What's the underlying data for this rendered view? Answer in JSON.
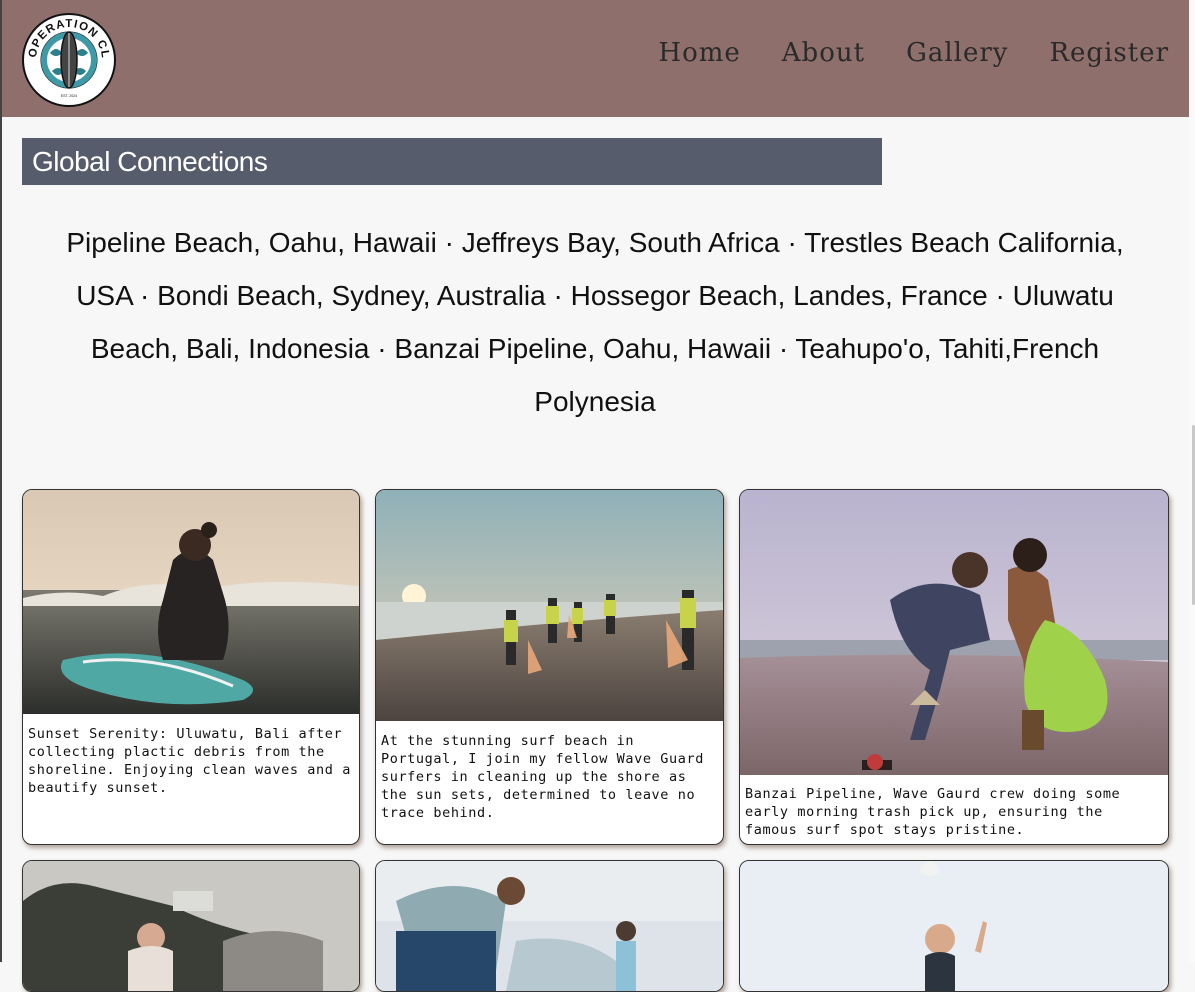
{
  "header": {
    "logo_text": "OPERATION CLEAN RIDE",
    "logo_subtext": "EST. 2024",
    "nav": [
      {
        "label": "Home"
      },
      {
        "label": "About"
      },
      {
        "label": "Gallery"
      },
      {
        "label": "Register"
      }
    ],
    "background_color": "#8f6f6b"
  },
  "section": {
    "title": "Global Connections",
    "bar_color": "#575c6d"
  },
  "locations_text": "Pipeline Beach, Oahu, Hawaii  · Jeffreys Bay, South Africa · Trestles Beach California, USA  · Bondi Beach, Sydney, Australia · Hossegor Beach, Landes, France · Uluwatu Beach, Bali, Indonesia · Banzai Pipeline, Oahu, Hawaii · Teahupo'o, Tahiti,French Polynesia",
  "gallery": [
    {
      "image": "surfer-sitting-on-board-in-ocean-at-sunset",
      "caption": "Sunset Serenity: Uluwatu, Bali after collecting plactic debris from the shoreline. Enjoying clean waves and a beautify sunset."
    },
    {
      "image": "volunteers-in-vests-collecting-trash-on-beach-at-sunset",
      "caption": "At the stunning surf beach in Portugal, I join my fellow Wave Guard surfers in cleaning up the shore as the sun sets, determined to leave no trace behind."
    },
    {
      "image": "two-people-picking-up-trash-with-green-bag",
      "caption": "Banzai Pipeline, Wave Gaurd crew doing some early morning trash pick up, ensuring the famous surf spot stays pristine."
    },
    {
      "image": "man-on-rocky-beach-with-cliffs",
      "caption": ""
    },
    {
      "image": "volunteers-bending-over-picking-up-litter",
      "caption": ""
    },
    {
      "image": "smiling-woman-on-beach-pointing-up",
      "caption": ""
    }
  ]
}
